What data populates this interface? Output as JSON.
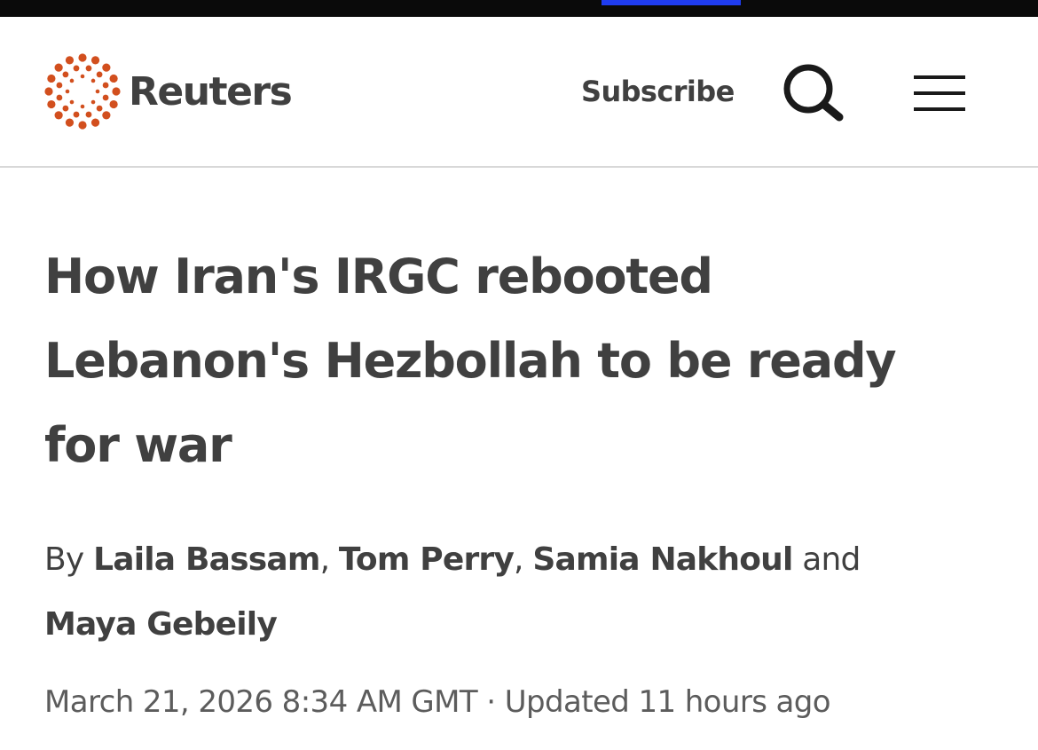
{
  "header": {
    "logo_text": "Reuters",
    "subscribe_label": "Subscribe",
    "search_icon": "search-icon",
    "menu_icon": "hamburger-menu-icon",
    "accent_color": "#d24f1e"
  },
  "article": {
    "headline_lines": [
      "How Iran's IRGC rebooted",
      "Lebanon's Hezbollah to be ready",
      "for war"
    ],
    "byline": {
      "prefix": "By",
      "authors": [
        "Laila Bassam",
        "Tom Perry",
        "Samia Nakhoul",
        "Maya Gebeily"
      ],
      "separator": ",",
      "conjunction": "and"
    },
    "dateline": {
      "published": "March 21, 2026 8:34 AM GMT",
      "separator": "·",
      "updated": "Updated 11 hours ago"
    }
  }
}
